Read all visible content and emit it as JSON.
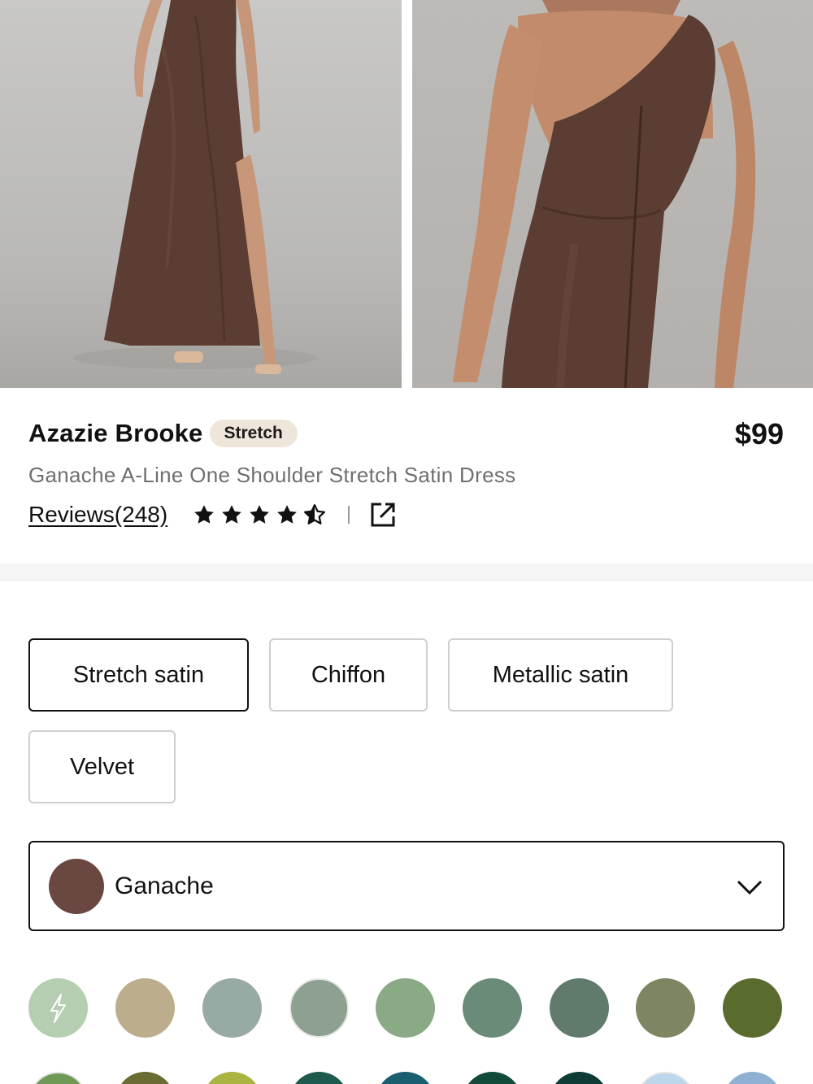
{
  "product": {
    "name": "Azazie Brooke",
    "badge": "Stretch",
    "price": "$99",
    "subtitle": "Ganache A-Line One Shoulder Stretch Satin Dress",
    "reviews_label": "Reviews(248)",
    "rating": 4.5,
    "rating_max": 5
  },
  "fabrics": [
    {
      "label": "Stretch satin",
      "selected": true
    },
    {
      "label": "Chiffon",
      "selected": false
    },
    {
      "label": "Metallic satin",
      "selected": false
    },
    {
      "label": "Velvet",
      "selected": false
    }
  ],
  "color_select": {
    "selected_name": "Ganache",
    "selected_color": "#6b4741"
  },
  "swatches_row1": [
    "#b5cdb1",
    "#bcae8c",
    "#97aaa4",
    "#8ea08f",
    "#8aa985",
    "#6a8b78",
    "#607b6c",
    "#7e8563",
    "#5a6b2e"
  ],
  "swatches_row2": [
    "#6f9a55",
    "#6b6b34",
    "#a9b441",
    "#1f5a4f",
    "#1a5f70",
    "#114a3b",
    "#0e3b34",
    "#bcd7ec",
    "#8fb0d3"
  ],
  "colors": {
    "dress": "#5a3c32",
    "badge_bg": "#efe6db",
    "text_muted": "#6f6f6f",
    "border_selected": "#111111",
    "border_default": "#cfcfcf"
  },
  "icons": {
    "star": "star-icon",
    "share": "external-link-icon",
    "chevron": "chevron-down-icon",
    "flash": "lightning-icon"
  }
}
